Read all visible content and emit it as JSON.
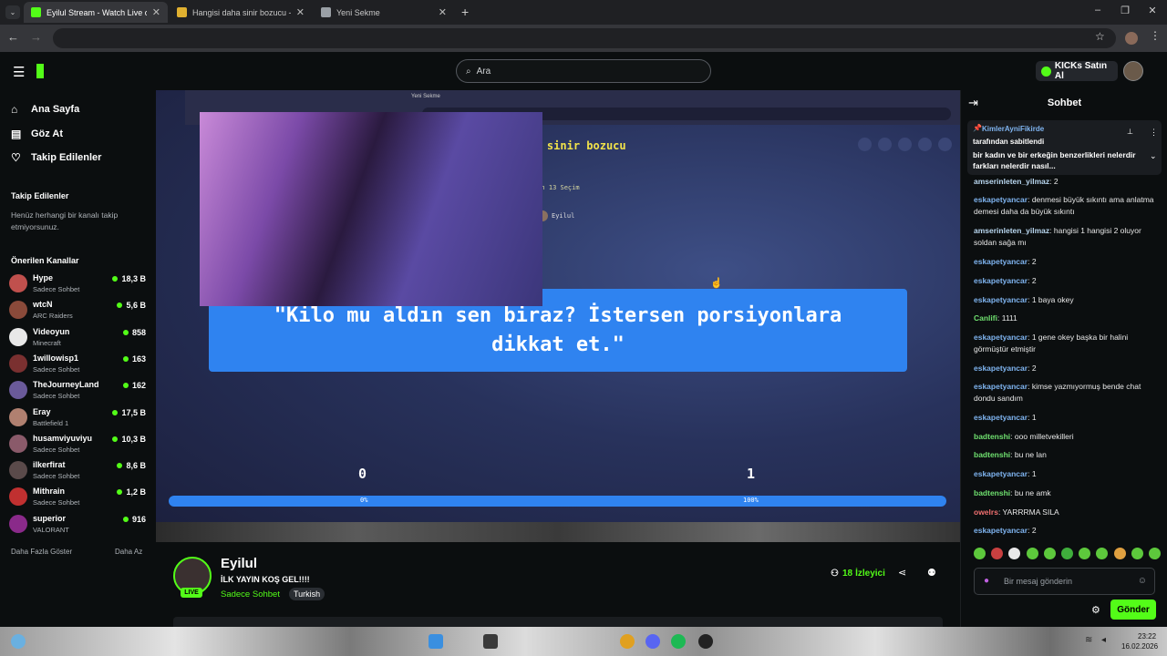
{
  "browser": {
    "tabs": [
      {
        "title": "Eyilul Stream - Watch Live on Kick",
        "active": true,
        "color": "#53fc18"
      },
      {
        "title": "Hangisi daha sinir bozucu - Tier",
        "active": false,
        "color": "#e0b030"
      },
      {
        "title": "Yeni Sekme",
        "active": false,
        "color": "#9aa0a6"
      }
    ],
    "new_tab": "+",
    "window_controls": [
      "–",
      "❐",
      "✕"
    ]
  },
  "header": {
    "search_placeholder": "Ara",
    "buy_kicks": "KICKs Satın Al"
  },
  "sidebar": {
    "nav": [
      "Ana Sayfa",
      "Göz At",
      "Takip Edilenler"
    ],
    "following_title": "Takip Edilenler",
    "following_empty": "Henüz herhangi bir kanalı takip etmiyorsunuz.",
    "recommended_title": "Önerilen Kanallar",
    "channels": [
      {
        "name": "Hype",
        "category": "Sadece Sohbet",
        "viewers": "18,3 B",
        "color": "#c0504d"
      },
      {
        "name": "wtcN",
        "category": "ARC Raiders",
        "viewers": "5,6 B",
        "color": "#8a4a3a"
      },
      {
        "name": "Videoyun",
        "category": "Minecraft",
        "viewers": "858",
        "color": "#e8e8e8"
      },
      {
        "name": "1willowisp1",
        "category": "Sadece Sohbet",
        "viewers": "163",
        "color": "#7a3030"
      },
      {
        "name": "TheJourneyLand",
        "category": "Sadece Sohbet",
        "viewers": "162",
        "color": "#6a5a9a"
      },
      {
        "name": "Eray",
        "category": "Battlefield 1",
        "viewers": "17,5 B",
        "color": "#b08070"
      },
      {
        "name": "husamviyuviyu",
        "category": "Sadece Sohbet",
        "viewers": "10,3 B",
        "color": "#8a5a6a"
      },
      {
        "name": "ilkerfirat",
        "category": "Sadece Sohbet",
        "viewers": "8,6 B",
        "color": "#5a4a4a"
      },
      {
        "name": "Mithrain",
        "category": "Sadece Sohbet",
        "viewers": "1,2 B",
        "color": "#c03030"
      },
      {
        "name": "superior",
        "category": "VALORANT",
        "viewers": "916",
        "color": "#8a2a8a"
      }
    ],
    "show_more": "Daha Fazla Göster",
    "show_less": "Daha Az"
  },
  "game": {
    "title": "Hangisi daha sinir bozucu",
    "subtitle": "Son 13 Seçim",
    "host": "Eyilul",
    "quote": "\"Kilo mu aldın sen biraz? İstersen porsiyonlara dikkat et.\"",
    "score_left": "0",
    "score_right": "1",
    "percent_left": "0%",
    "percent_right": "100%",
    "inner_tab": "Yeni Sekme"
  },
  "stream": {
    "streamer": "Eyilul",
    "live_label": "LIVE",
    "title": "İLK YAYIN KOŞ GEL!!!!",
    "category": "Sadece Sohbet",
    "language": "Turkish",
    "viewer_count": "18",
    "viewer_label": "İzleyici"
  },
  "chat": {
    "title": "Sohbet",
    "pinned_user": "KimlerAyniFikirde",
    "pinned_by": "tarafından sabitlendi",
    "pinned_text": "bir kadın ve bir erkeğin benzerlikleri nelerdir farkları nelerdir nasıl...",
    "messages": [
      {
        "user": "amserinleten_yilmaz",
        "text": "2",
        "color": "#b9d7f0"
      },
      {
        "user": "eskapetyancar",
        "text": "denmesi büyük sıkıntı ama anlatma demesi daha da büyük sıkıntı",
        "color": "#7fb4f0"
      },
      {
        "user": "amserinleten_yilmaz",
        "text": "hangisi 1 hangisi 2 oluyor soldan sağa mı",
        "color": "#b9d7f0"
      },
      {
        "user": "eskapetyancar",
        "text": "2",
        "color": "#7fb4f0"
      },
      {
        "user": "eskapetyancar",
        "text": "2",
        "color": "#7fb4f0"
      },
      {
        "user": "eskapetyancar",
        "text": "1 baya okey",
        "color": "#7fb4f0"
      },
      {
        "user": "Canlifi",
        "text": "1111",
        "color": "#6fe06f"
      },
      {
        "user": "eskapetyancar",
        "text": "1 gene okey başka bir halini görmüştür etmiştir",
        "color": "#7fb4f0"
      },
      {
        "user": "eskapetyancar",
        "text": "2",
        "color": "#7fb4f0"
      },
      {
        "user": "eskapetyancar",
        "text": "kimse yazmıyormuş bende chat dondu sandım",
        "color": "#7fb4f0"
      },
      {
        "user": "eskapetyancar",
        "text": "1",
        "color": "#7fb4f0"
      },
      {
        "user": "badtenshi",
        "text": "ooo milletvekilleri",
        "color": "#6fe06f"
      },
      {
        "user": "badtenshi",
        "text": "bu ne lan",
        "color": "#6fe06f"
      },
      {
        "user": "eskapetyancar",
        "text": "1",
        "color": "#7fb4f0"
      },
      {
        "user": "badtenshi",
        "text": "bu ne amk",
        "color": "#6fe06f"
      },
      {
        "user": "owelrs",
        "text": "YARRRMA SILA",
        "color": "#f07070"
      },
      {
        "user": "eskapetyancar",
        "text": "2",
        "color": "#7fb4f0"
      }
    ],
    "input_placeholder": "Bir mesaj gönderin",
    "send": "Gönder"
  },
  "taskbar": {
    "time": "23:22",
    "date": "16.02.2026"
  },
  "colors": {
    "accent": "#53fc18",
    "quote_box": "#2f83f0",
    "game_title": "#f2e34a"
  }
}
